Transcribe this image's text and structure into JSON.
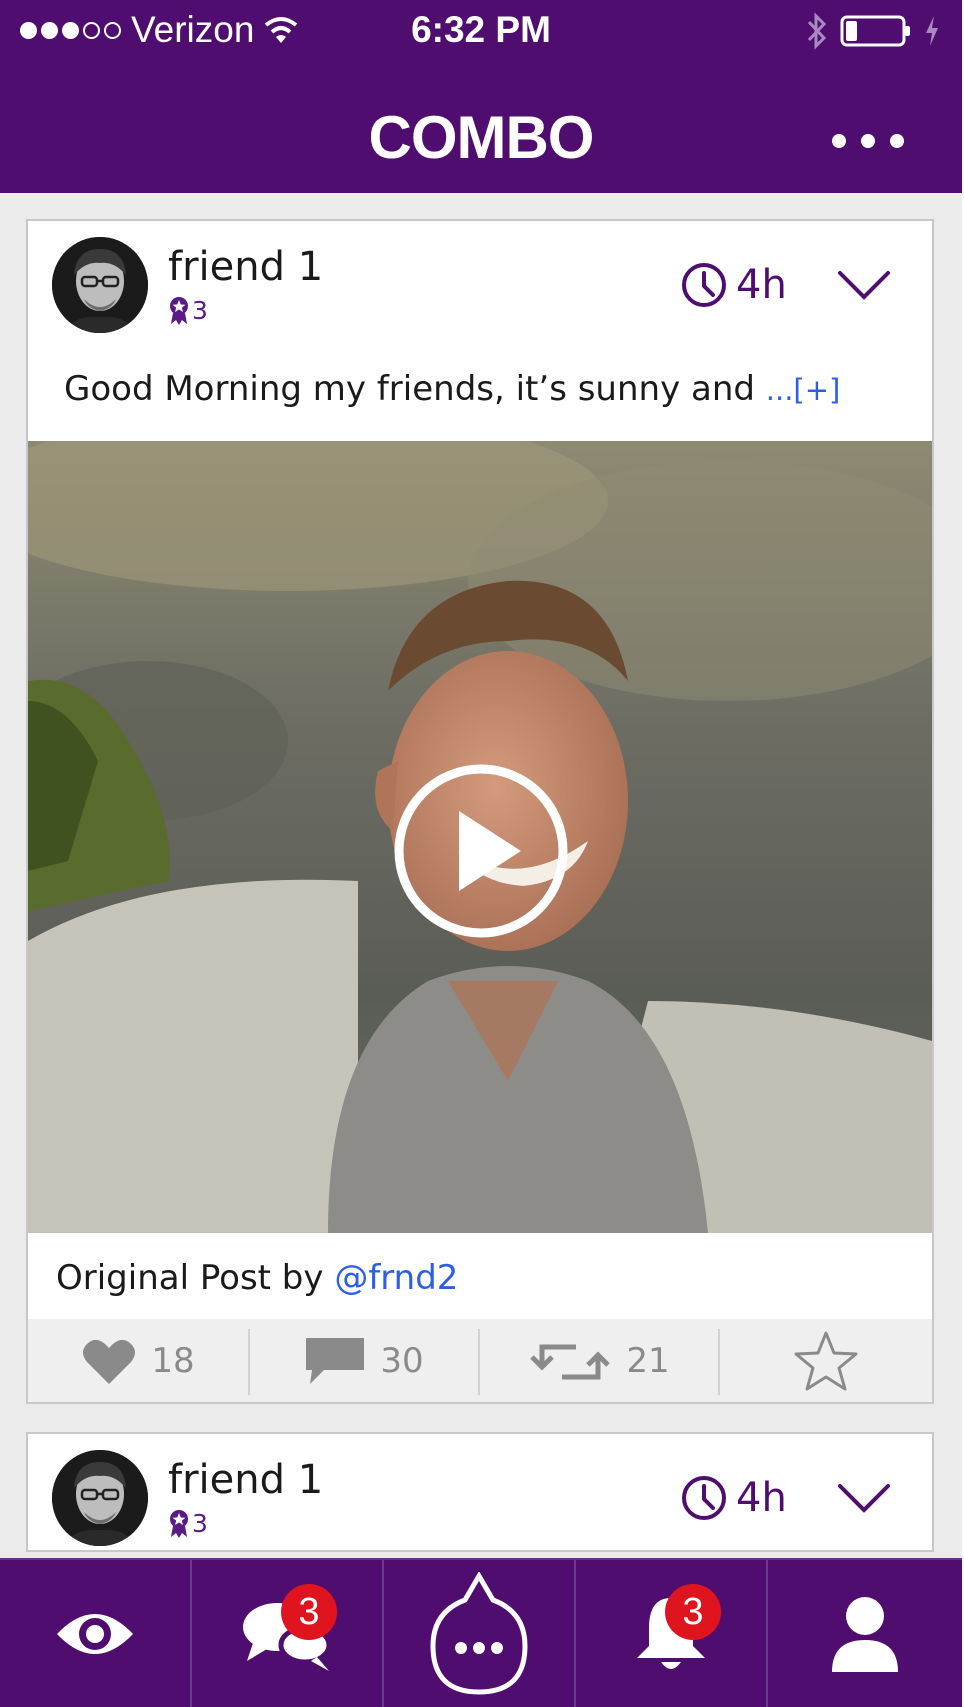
{
  "status_bar": {
    "carrier": "Verizon",
    "time": "6:32 PM",
    "signal_bars_filled": 3,
    "signal_bars_total": 5,
    "battery_level": 0.2
  },
  "header": {
    "title": "COMBO",
    "menu_icon": "more-horizontal-icon"
  },
  "posts": [
    {
      "author": "friend 1",
      "badge_count": "3",
      "time": "4h",
      "text": "Good Morning my friends, it’s sunny and ",
      "more_label": "...[+]",
      "original_post_prefix": "Original Post by ",
      "original_post_handle": "@frnd2",
      "likes": "18",
      "comments": "30",
      "reposts": "21"
    },
    {
      "author": "friend 1",
      "badge_count": "3",
      "time": "4h"
    }
  ],
  "tab_bar": {
    "tabs": [
      {
        "name": "watch",
        "icon": "eye-icon"
      },
      {
        "name": "messages",
        "icon": "chat-bubbles-icon",
        "badge": "3"
      },
      {
        "name": "compose",
        "icon": "combo-bubble-icon"
      },
      {
        "name": "notifications",
        "icon": "bell-icon",
        "badge": "3"
      },
      {
        "name": "profile",
        "icon": "person-icon"
      }
    ]
  },
  "colors": {
    "brand_purple": "#4f0e6f",
    "link_blue": "#2d5fe4",
    "badge_red": "#e0141e",
    "action_gray": "#8a8a8a"
  }
}
